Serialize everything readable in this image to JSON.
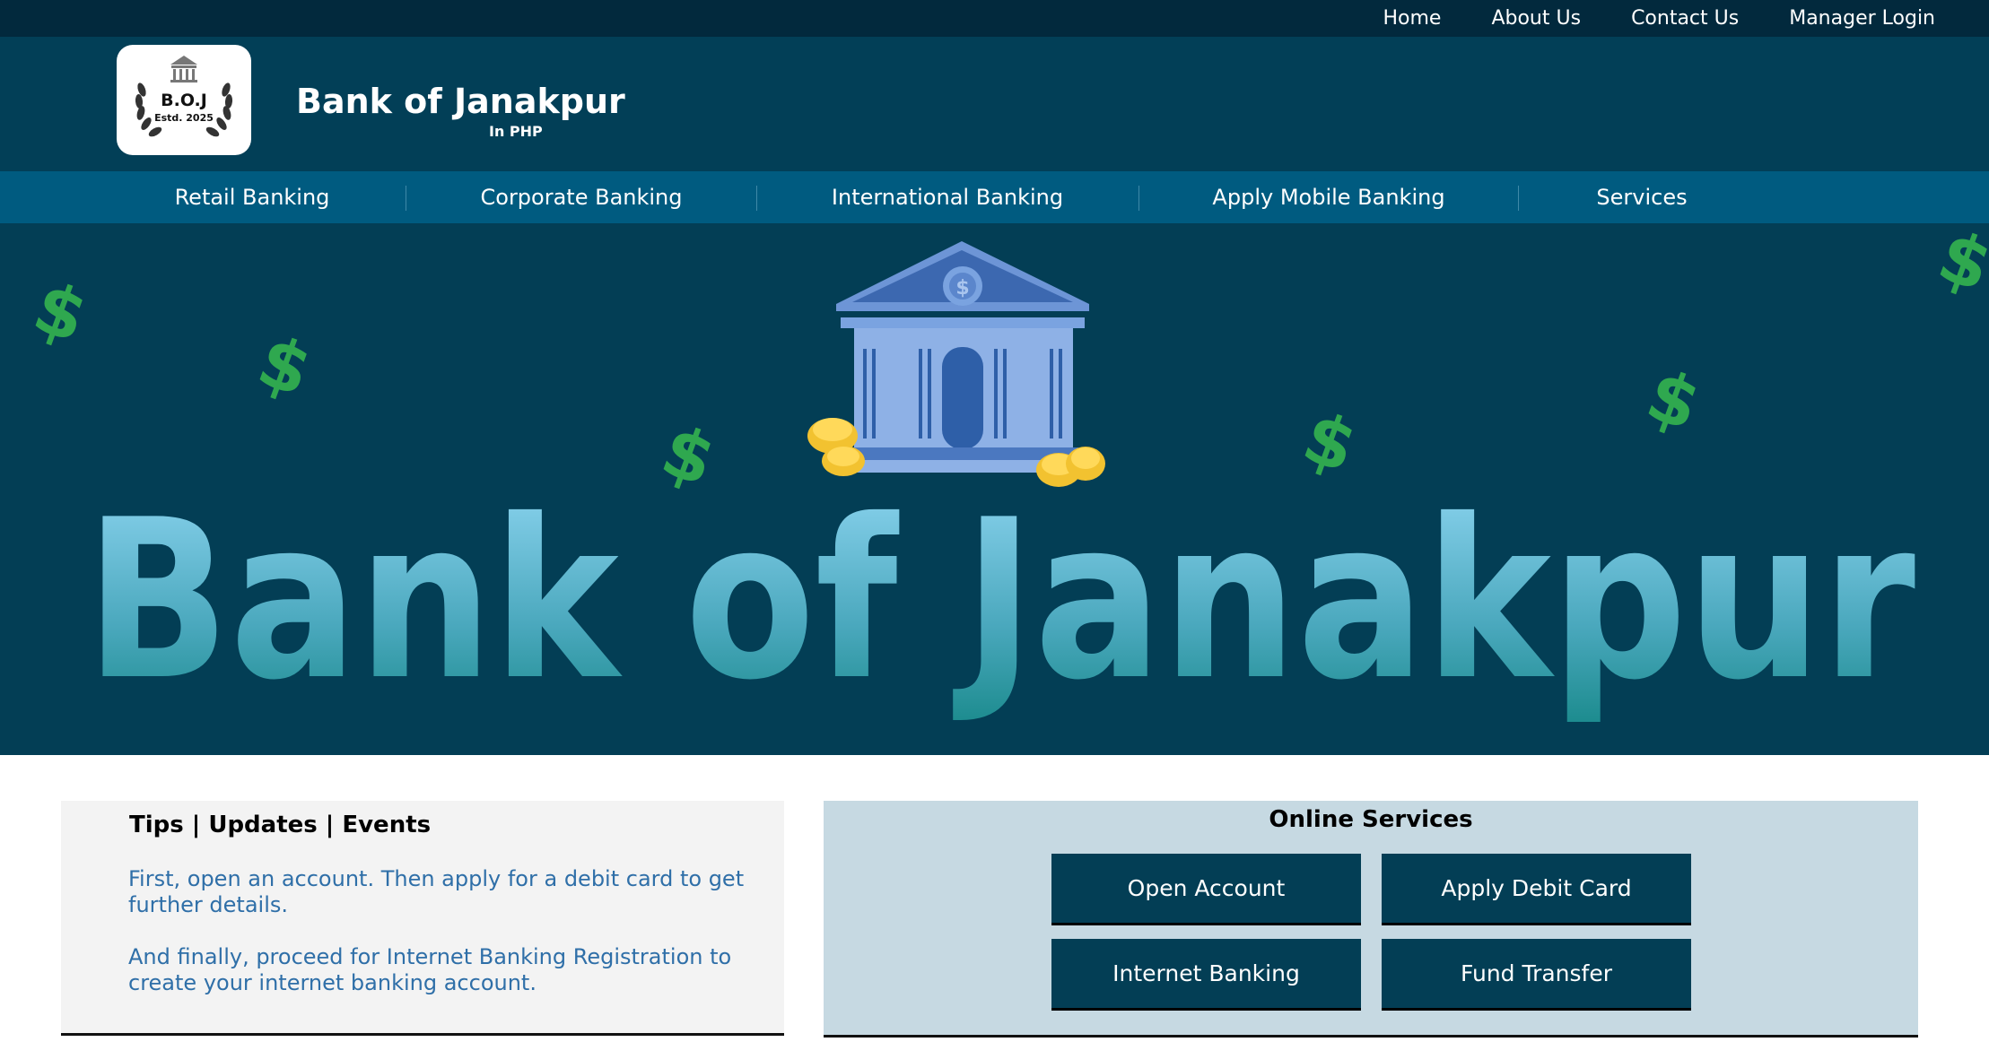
{
  "top_nav": [
    "Home",
    "About Us",
    "Contact Us",
    "Manager Login"
  ],
  "brand": {
    "logo_text": "B.O.J",
    "logo_estd": "Estd. 2025",
    "title": "Bank of Janakpur",
    "subtitle": "In PHP"
  },
  "main_nav": [
    "Retail Banking",
    "Corporate Banking",
    "International Banking",
    "Apply Mobile Banking",
    "Services"
  ],
  "hero": {
    "banner_text": "Bank of Janakpur",
    "dollar_glyph": "$"
  },
  "tips": {
    "heading": "Tips | Updates | Events",
    "p1": "First, open an account. Then apply for a debit card to get further details.",
    "p2": "And finally, proceed for Internet Banking Registration to create your internet banking account."
  },
  "online_services": {
    "heading": "Online Services",
    "buttons": [
      "Open Account",
      "Apply Debit Card",
      "Internet Banking",
      "Fund Transfer"
    ]
  },
  "colors": {
    "topbar": "#02293d",
    "header": "#023f57",
    "nav": "#005b80",
    "hero": "#033e55",
    "tips_text": "#2f6fa8",
    "services_bg": "#c6d9e2"
  }
}
